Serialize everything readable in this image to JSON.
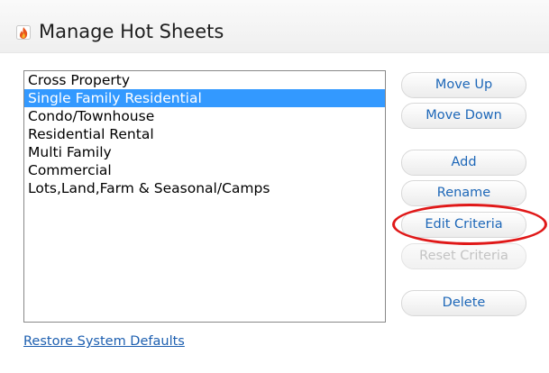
{
  "header": {
    "title": "Manage Hot Sheets",
    "icon": "hot-sheet-flame-icon"
  },
  "list": {
    "items": [
      {
        "label": "Cross Property",
        "selected": false
      },
      {
        "label": "Single Family Residential",
        "selected": true
      },
      {
        "label": "Condo/Townhouse",
        "selected": false
      },
      {
        "label": "Residential Rental",
        "selected": false
      },
      {
        "label": "Multi Family",
        "selected": false
      },
      {
        "label": "Commercial",
        "selected": false
      },
      {
        "label": "Lots,Land,Farm & Seasonal/Camps",
        "selected": false
      }
    ]
  },
  "buttons": {
    "move_up": "Move Up",
    "move_down": "Move Down",
    "add": "Add",
    "rename": "Rename",
    "edit_criteria": "Edit Criteria",
    "reset_criteria": "Reset Criteria",
    "delete": "Delete"
  },
  "links": {
    "restore_defaults": "Restore System Defaults"
  },
  "colors": {
    "selection": "#3399ff",
    "button_text": "#1d67b8",
    "disabled_text": "#c3c3c3",
    "highlight_ring": "#e01818",
    "link": "#1d5fb0"
  }
}
